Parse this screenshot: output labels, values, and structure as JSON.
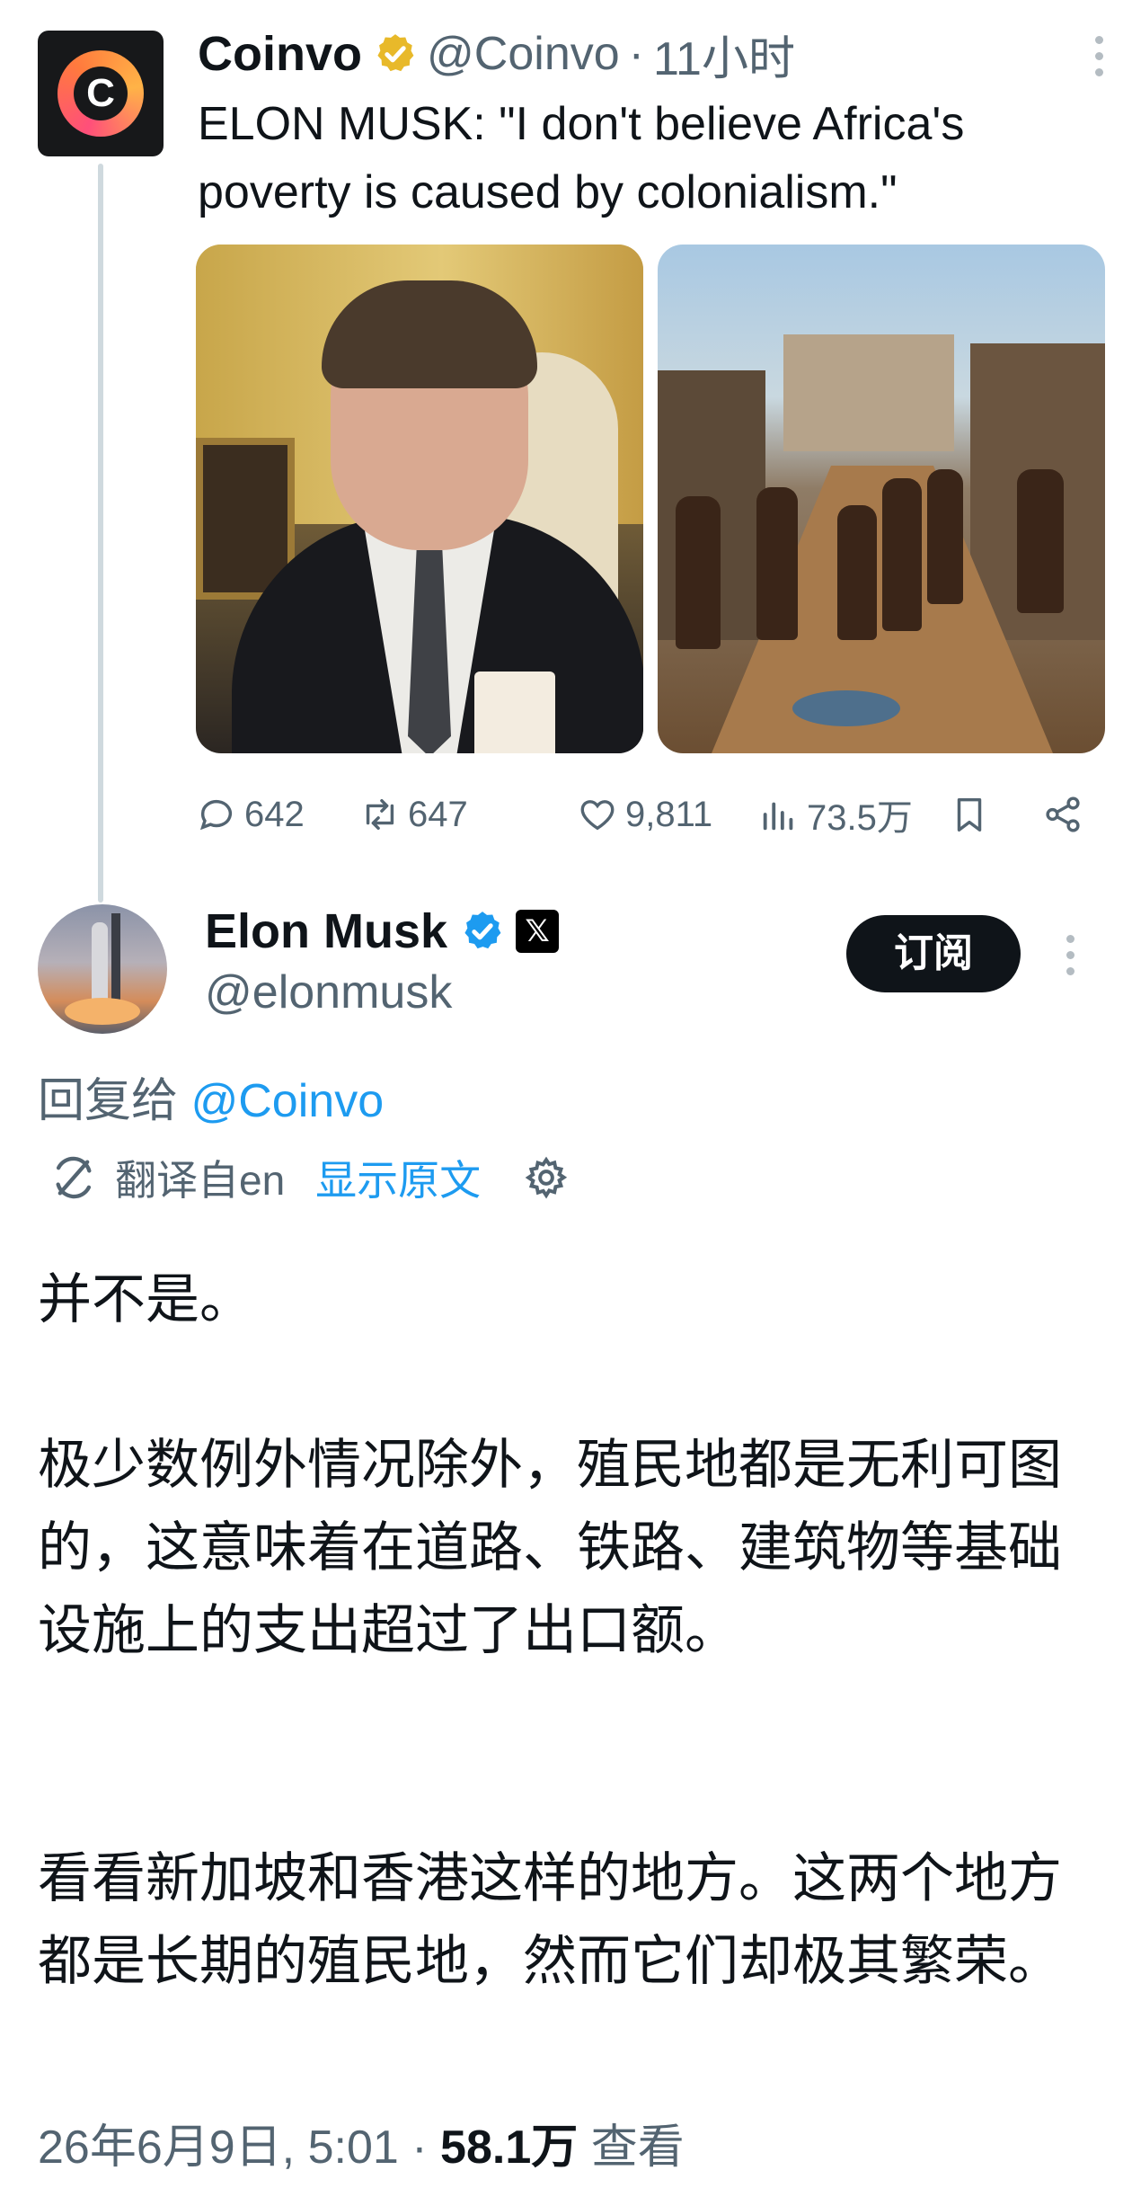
{
  "quoted_tweet": {
    "author_name": "Coinvo",
    "handle": "@Coinvo",
    "separator": "·",
    "time_ago": "11小时",
    "text": "ELON MUSK: \"I don't believe Africa's poverty is caused by colonialism.\"",
    "avatar_letter": "C",
    "stats": {
      "replies": "642",
      "reposts": "647",
      "likes": "9,811",
      "views": "73.5万"
    }
  },
  "main_tweet": {
    "author_name": "Elon Musk",
    "handle": "@elonmusk",
    "x_badge": "𝕏",
    "subscribe_label": "订阅",
    "reply_prefix": "回复给",
    "reply_mention": "@Coinvo",
    "translated_from": "翻译自en",
    "show_original": "显示原文",
    "paragraphs": [
      "并不是。",
      "极少数例外情况除外，殖民地都是无利可图的，这意味着在道路、铁路、建筑物等基础设施上的支出超过了出口额。",
      "看看新加坡和香港这样的地方。这两个地方都是长期的殖民地，然而它们却极其繁荣。"
    ],
    "date_time": "26年6月9日, 5:01",
    "separator": "·",
    "views_count": "58.1万",
    "views_label": "查看"
  },
  "colors": {
    "accent": "#1d9bf0",
    "gold_badge": "#e8b92a",
    "secondary_text": "#536471",
    "button_bg": "#0f1419"
  },
  "icons": [
    "more-icon",
    "gold-verified-icon",
    "reply-icon",
    "repost-icon",
    "like-icon",
    "views-icon",
    "bookmark-icon",
    "share-icon",
    "blue-verified-icon",
    "x-logo-icon",
    "translate-icon",
    "gear-icon"
  ]
}
